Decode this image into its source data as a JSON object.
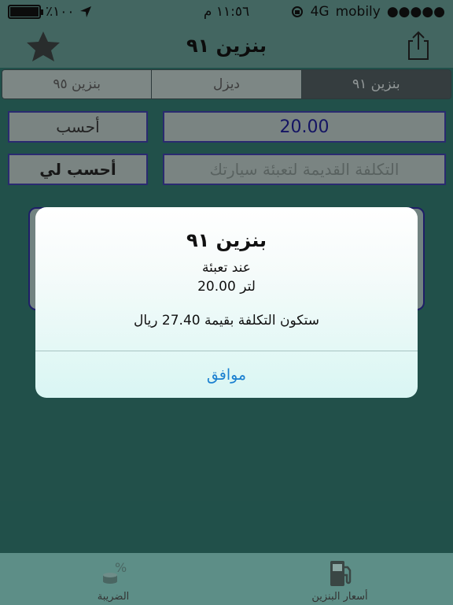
{
  "status_bar": {
    "battery_percent": "٪١٠٠",
    "battery_level": 1.0,
    "time": "١١:٥٦ م",
    "network": "4G",
    "carrier": "mobily",
    "signal": "●●●●●"
  },
  "nav": {
    "title": "بنزين ٩١"
  },
  "segments": [
    {
      "label": "بنزين ٩٥"
    },
    {
      "label": "ديزل"
    },
    {
      "label": "بنزين ٩١",
      "selected": true
    }
  ],
  "form": {
    "calc_button": "أحسب",
    "value": "20.00",
    "calc_for_me_button": "أحسب لي",
    "old_cost_placeholder": "التكلفة القديمة لتعبئة سيارتك"
  },
  "alert": {
    "title": "بنزين ٩١",
    "line1": "عند تعبئة",
    "line2": "20.00 لتر",
    "message": "ستكون التكلفة بقيمة 27.40 ريال",
    "ok_label": "موافق"
  },
  "tabs": [
    {
      "label": "الضريبة",
      "icon": "tax-percent-icon"
    },
    {
      "label": "أسعار البنزين",
      "icon": "fuel-pump-icon"
    }
  ],
  "colors": {
    "background": "#2f6f67",
    "bar": "#5d8e87",
    "link_blue": "#1a7fd0"
  }
}
